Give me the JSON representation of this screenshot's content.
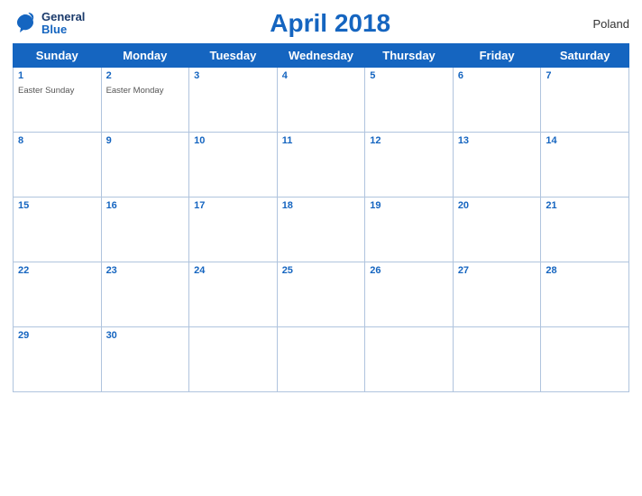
{
  "header": {
    "logo": {
      "line1": "General",
      "line2": "Blue"
    },
    "title": "April 2018",
    "country": "Poland"
  },
  "days_of_week": [
    "Sunday",
    "Monday",
    "Tuesday",
    "Wednesday",
    "Thursday",
    "Friday",
    "Saturday"
  ],
  "weeks": [
    [
      {
        "num": "1",
        "holiday": "Easter Sunday"
      },
      {
        "num": "2",
        "holiday": "Easter Monday"
      },
      {
        "num": "3",
        "holiday": ""
      },
      {
        "num": "4",
        "holiday": ""
      },
      {
        "num": "5",
        "holiday": ""
      },
      {
        "num": "6",
        "holiday": ""
      },
      {
        "num": "7",
        "holiday": ""
      }
    ],
    [
      {
        "num": "8",
        "holiday": ""
      },
      {
        "num": "9",
        "holiday": ""
      },
      {
        "num": "10",
        "holiday": ""
      },
      {
        "num": "11",
        "holiday": ""
      },
      {
        "num": "12",
        "holiday": ""
      },
      {
        "num": "13",
        "holiday": ""
      },
      {
        "num": "14",
        "holiday": ""
      }
    ],
    [
      {
        "num": "15",
        "holiday": ""
      },
      {
        "num": "16",
        "holiday": ""
      },
      {
        "num": "17",
        "holiday": ""
      },
      {
        "num": "18",
        "holiday": ""
      },
      {
        "num": "19",
        "holiday": ""
      },
      {
        "num": "20",
        "holiday": ""
      },
      {
        "num": "21",
        "holiday": ""
      }
    ],
    [
      {
        "num": "22",
        "holiday": ""
      },
      {
        "num": "23",
        "holiday": ""
      },
      {
        "num": "24",
        "holiday": ""
      },
      {
        "num": "25",
        "holiday": ""
      },
      {
        "num": "26",
        "holiday": ""
      },
      {
        "num": "27",
        "holiday": ""
      },
      {
        "num": "28",
        "holiday": ""
      }
    ],
    [
      {
        "num": "29",
        "holiday": ""
      },
      {
        "num": "30",
        "holiday": ""
      },
      {
        "num": "",
        "holiday": ""
      },
      {
        "num": "",
        "holiday": ""
      },
      {
        "num": "",
        "holiday": ""
      },
      {
        "num": "",
        "holiday": ""
      },
      {
        "num": "",
        "holiday": ""
      }
    ]
  ],
  "colors": {
    "header_bg": "#1565c0",
    "accent": "#1565c0"
  }
}
